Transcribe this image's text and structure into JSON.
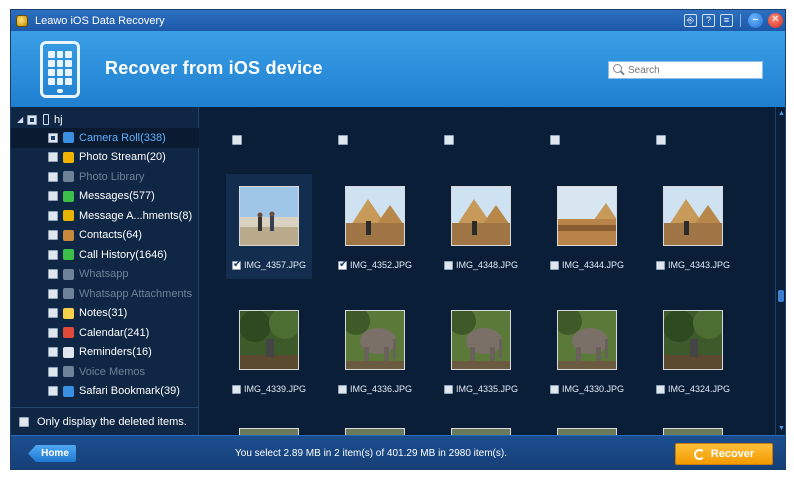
{
  "window": {
    "title": "Leawo iOS Data Recovery"
  },
  "titlebar_buttons": [
    "register-icon",
    "help-icon",
    "menu-icon",
    "minimize-icon",
    "close-icon"
  ],
  "header": {
    "title": "Recover from iOS device",
    "search_placeholder": "Search"
  },
  "sidebar": {
    "device_name": "hj",
    "items": [
      {
        "label": "Camera Roll(338)",
        "icon": "camera-roll-icon",
        "color": "#3a8fe0",
        "state": "selected"
      },
      {
        "label": "Photo Stream(20)",
        "icon": "photo-stream-icon",
        "color": "#f0b400",
        "state": "normal"
      },
      {
        "label": "Photo Library",
        "icon": "photo-library-icon",
        "color": "#6e8297",
        "state": "disabled"
      },
      {
        "label": "Messages(577)",
        "icon": "messages-icon",
        "color": "#3cc04a",
        "state": "normal"
      },
      {
        "label": "Message A...hments(8)",
        "icon": "message-attachments-icon",
        "color": "#e8b400",
        "state": "normal"
      },
      {
        "label": "Contacts(64)",
        "icon": "contacts-icon",
        "color": "#c88a3a",
        "state": "normal"
      },
      {
        "label": "Call History(1646)",
        "icon": "call-history-icon",
        "color": "#3cc04a",
        "state": "normal"
      },
      {
        "label": "Whatsapp",
        "icon": "whatsapp-icon",
        "color": "#6e8297",
        "state": "disabled"
      },
      {
        "label": "Whatsapp Attachments",
        "icon": "whatsapp-attachments-icon",
        "color": "#6e8297",
        "state": "disabled"
      },
      {
        "label": "Notes(31)",
        "icon": "notes-icon",
        "color": "#f5d24a",
        "state": "normal"
      },
      {
        "label": "Calendar(241)",
        "icon": "calendar-icon",
        "color": "#e04a3a",
        "state": "normal"
      },
      {
        "label": "Reminders(16)",
        "icon": "reminders-icon",
        "color": "#dfe6ee",
        "state": "normal"
      },
      {
        "label": "Voice Memos",
        "icon": "voice-memos-icon",
        "color": "#6e8297",
        "state": "disabled"
      },
      {
        "label": "Safari Bookmark(39)",
        "icon": "safari-bookmark-icon",
        "color": "#3a8fe0",
        "state": "normal"
      }
    ],
    "footer_label": "Only display the deleted items."
  },
  "gallery": {
    "rows": [
      [
        {
          "name": "IMG_4357.JPG",
          "checked": true,
          "scene": "sky"
        },
        {
          "name": "IMG_4352.JPG",
          "checked": true,
          "scene": "pyramid"
        },
        {
          "name": "IMG_4348.JPG",
          "checked": false,
          "scene": "pyramid"
        },
        {
          "name": "IMG_4344.JPG",
          "checked": false,
          "scene": "desert"
        },
        {
          "name": "IMG_4343.JPG",
          "checked": false,
          "scene": "pyramid"
        }
      ],
      [
        {
          "name": "IMG_4339.JPG",
          "checked": false,
          "scene": "forest"
        },
        {
          "name": "IMG_4336.JPG",
          "checked": false,
          "scene": "elephant"
        },
        {
          "name": "IMG_4335.JPG",
          "checked": false,
          "scene": "elephant"
        },
        {
          "name": "IMG_4330.JPG",
          "checked": false,
          "scene": "elephant"
        },
        {
          "name": "IMG_4324.JPG",
          "checked": false,
          "scene": "forest"
        }
      ]
    ]
  },
  "footer": {
    "home_label": "Home",
    "status": "You select 2.89 MB in 2 item(s) of 401.29 MB in 2980 item(s).",
    "recover_label": "Recover"
  }
}
